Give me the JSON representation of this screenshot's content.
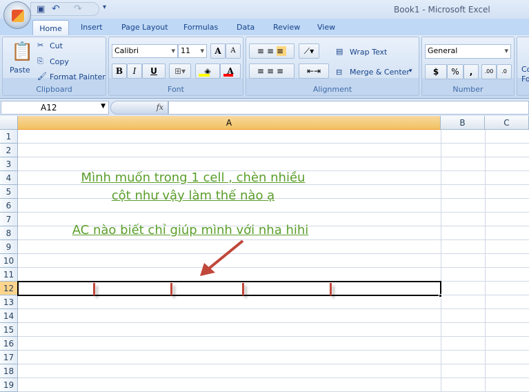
{
  "window": {
    "title": "Book1  -  Microsoft Excel"
  },
  "ribbon": {
    "tabs": [
      "Home",
      "Insert",
      "Page Layout",
      "Formulas",
      "Data",
      "Review",
      "View"
    ],
    "active_tab": "Home",
    "clipboard": {
      "label": "Clipboard",
      "paste": "Paste",
      "cut": "Cut",
      "copy": "Copy",
      "format_painter": "Format Painter"
    },
    "font": {
      "label": "Font",
      "font_name": "Calibri",
      "font_size": "11",
      "bold": "B",
      "italic": "I",
      "underline": "U",
      "grow": "A",
      "shrink": "A",
      "font_color": "A",
      "fill_color_hex": "#ffff00",
      "font_color_hex": "#ff0000"
    },
    "alignment": {
      "label": "Alignment",
      "wrap_text": "Wrap Text",
      "merge_center": "Merge & Center"
    },
    "number": {
      "label": "Number",
      "format": "General",
      "currency": "$",
      "percent": "%",
      "comma": ",",
      "inc_decimal": ".00",
      "dec_decimal": ".0"
    },
    "styles": {
      "partial": "Co Fo"
    }
  },
  "formula_bar": {
    "name_box": "A12",
    "fx": "fx",
    "value": ""
  },
  "sheet": {
    "columns": [
      "A",
      "B",
      "C"
    ],
    "selected_column": "A",
    "rows": [
      "1",
      "2",
      "3",
      "4",
      "5",
      "6",
      "7",
      "8",
      "9",
      "10",
      "11",
      "12",
      "13",
      "14",
      "15",
      "16",
      "17",
      "18",
      "19"
    ],
    "selected_row": "12",
    "annotations": {
      "line1": "Mình muốn trong 1 cell , chèn nhiều ",
      "line2": "cột như vậy làm thế nào ạ",
      "line3": "AC nào biết chỉ giúp mình với nha hihi"
    },
    "annotation_color": "#5a9e2a",
    "arrow_color": "#c0473a"
  }
}
